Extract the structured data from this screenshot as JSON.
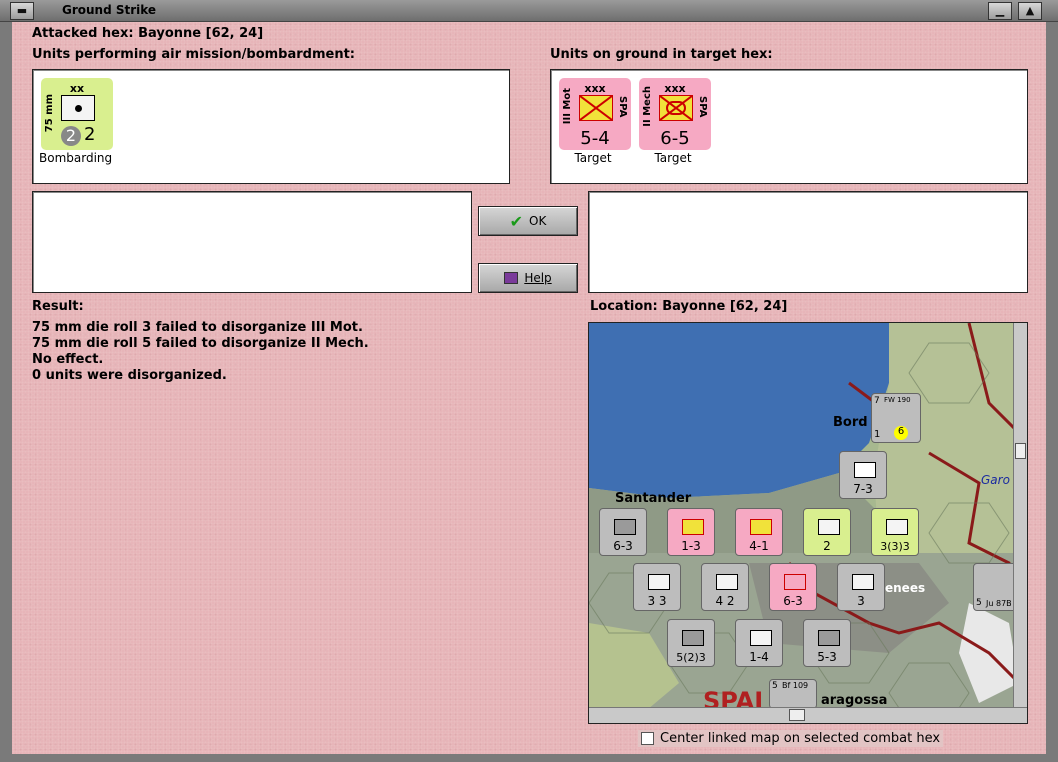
{
  "window": {
    "title": "Ground Strike"
  },
  "header": {
    "attacked_hex": "Attacked hex: Bayonne  [62, 24]",
    "units_air_label": "Units performing air mission/bombardment:",
    "units_ground_label": "Units on ground in target hex:"
  },
  "air_units": [
    {
      "type": "xx",
      "side_label": "75 mm",
      "attack": "2",
      "strength": "2",
      "caption": "Bombarding",
      "color": "#d9ef8f"
    }
  ],
  "ground_units": [
    {
      "type": "xxx",
      "side_label": "III Mot",
      "side_right": "SPA",
      "strength": "5-4",
      "caption": "Target",
      "color": "#f6a9c3"
    },
    {
      "type": "xxx",
      "side_label": "II Mech",
      "side_right": "SPA",
      "strength": "6-5",
      "caption": "Target",
      "color": "#f6a9c3"
    }
  ],
  "buttons": {
    "ok": "OK",
    "help": "Help"
  },
  "result": {
    "label": "Result:",
    "lines": [
      "75 mm die roll 3 failed to disorganize III Mot.",
      "75 mm die roll 5 failed to disorganize II Mech.",
      "No effect.",
      "0 units were disorganized."
    ]
  },
  "location": {
    "label": "Location:  Bayonne  [62, 24]"
  },
  "map": {
    "place_labels": [
      "Bord",
      "Santander",
      "Garo",
      "enees",
      "aragossa",
      "SPAI"
    ],
    "counters": [
      {
        "label": "FW 190",
        "top": "7",
        "bottom_left": "1",
        "bottom_right": "6",
        "kind": "air"
      },
      {
        "label": "7-3",
        "stack": "2",
        "kind": "inf"
      },
      {
        "label": "6-3",
        "stack": "3",
        "kind": "inf"
      },
      {
        "label": "1-3",
        "stack": "3",
        "kind": "pink"
      },
      {
        "label": "4-1",
        "stack": "4",
        "kind": "pink"
      },
      {
        "label": "2",
        "stack": "3",
        "kind": "green"
      },
      {
        "label": "3(3)3",
        "stack": "2",
        "kind": "green"
      },
      {
        "label": "3 3",
        "stack": "3",
        "kind": "art"
      },
      {
        "label": "4 2",
        "stack": "3",
        "kind": "art"
      },
      {
        "label": "6-3",
        "stack": "3",
        "kind": "pink"
      },
      {
        "label": "3",
        "stack": "3",
        "kind": "art"
      },
      {
        "label": "5(2)3",
        "stack": "",
        "kind": "inf"
      },
      {
        "label": "1-4",
        "stack": "3",
        "kind": "inf"
      },
      {
        "label": "5-3",
        "stack": "",
        "kind": "inf"
      },
      {
        "label": "Bf 109",
        "top": "5",
        "kind": "air"
      },
      {
        "label": "Ju 87B",
        "top": "5",
        "kind": "air"
      }
    ]
  },
  "checkbox": {
    "label": "Center linked map on selected combat hex",
    "checked": false
  }
}
